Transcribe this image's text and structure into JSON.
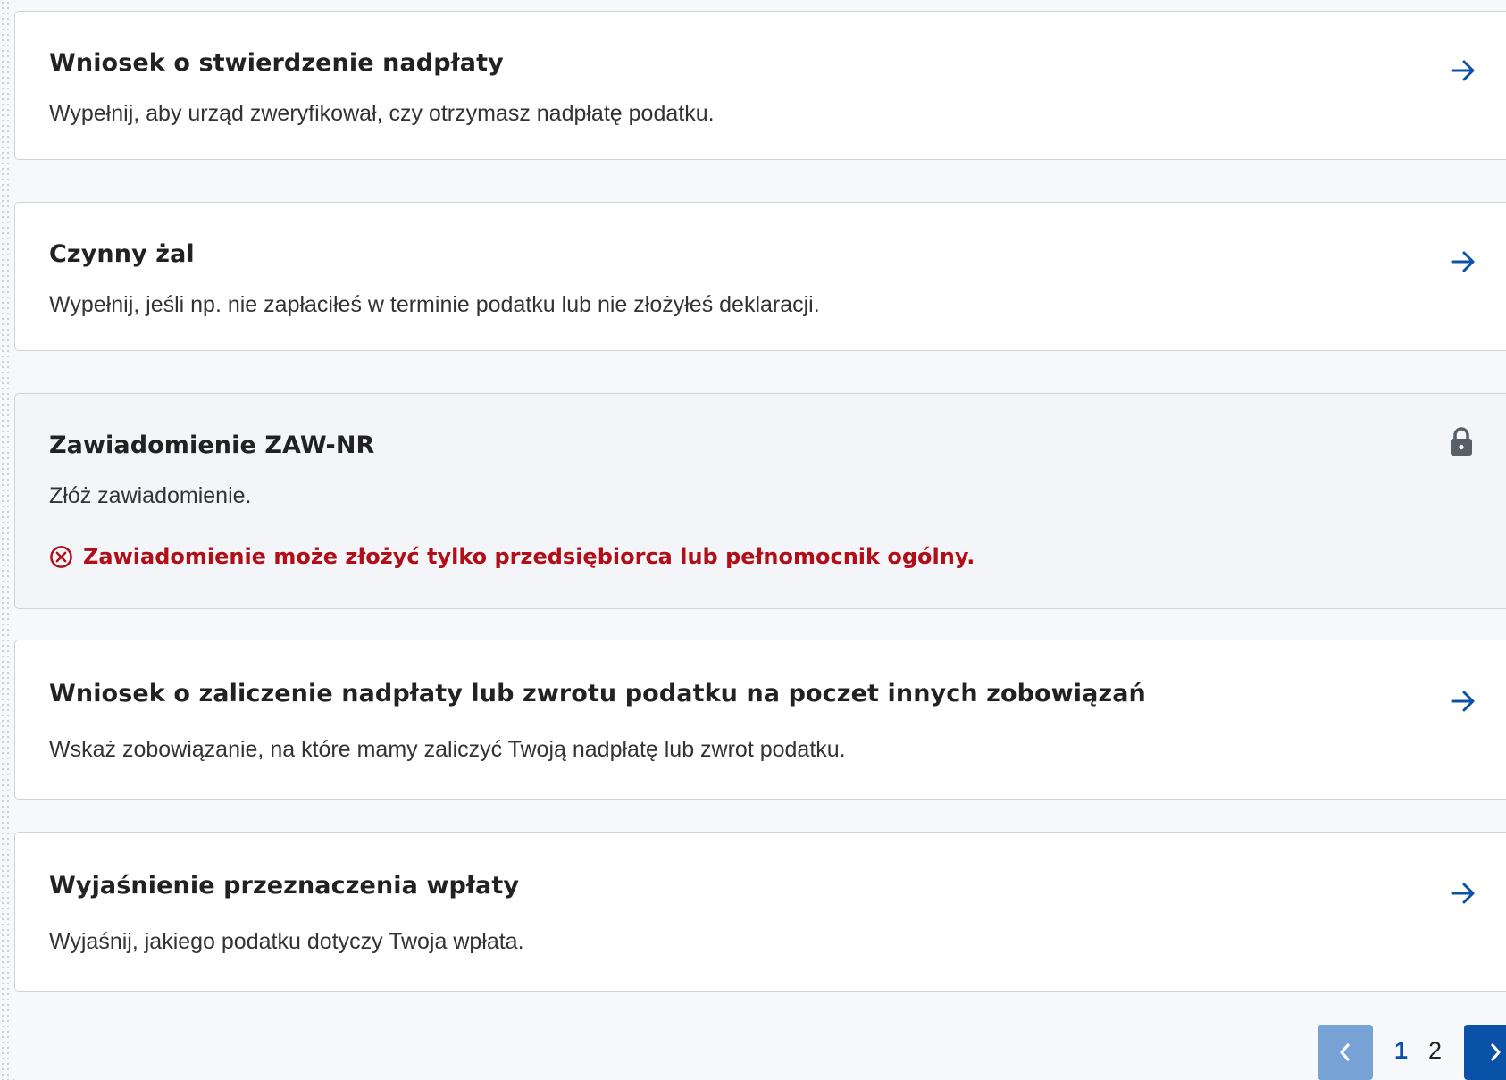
{
  "cards": [
    {
      "title": "Wniosek o stwierdzenie nadpłaty",
      "description": "Wypełnij, aby urząd zweryfikował, czy otrzymasz nadpłatę podatku.",
      "icon": "arrow-right-icon"
    },
    {
      "title": "Czynny żal",
      "description": "Wypełnij, jeśli np. nie zapłaciłeś w terminie podatku lub nie złożyłeś deklaracji.",
      "icon": "arrow-right-icon"
    },
    {
      "title": "Zawiadomienie ZAW-NR",
      "description": "Złóż zawiadomienie.",
      "icon": "lock-icon",
      "error": "Zawiadomienie może złożyć tylko przedsiębiorca lub pełnomocnik ogólny."
    },
    {
      "title": "Wniosek o zaliczenie nadpłaty lub zwrotu podatku na poczet innych zobowiązań",
      "description": "Wskaż zobowiązanie, na które mamy zaliczyć Twoją nadpłatę lub zwrot podatku.",
      "icon": "arrow-right-icon"
    },
    {
      "title": "Wyjaśnienie przeznaczenia wpłaty",
      "description": "Wyjaśnij, jakiego podatku dotyczy Twoja wpłata.",
      "icon": "arrow-right-icon"
    }
  ],
  "pagination": {
    "pages": [
      "1",
      "2"
    ],
    "current": "1",
    "prev_icon": "chevron-left-icon",
    "next_icon": "chevron-right-icon"
  },
  "colors": {
    "accent": "#0a52a8",
    "accent_disabled": "#76a2d5",
    "error": "#b20e18",
    "border": "#cfd3d9",
    "locked_bg": "#f4f5f8"
  }
}
